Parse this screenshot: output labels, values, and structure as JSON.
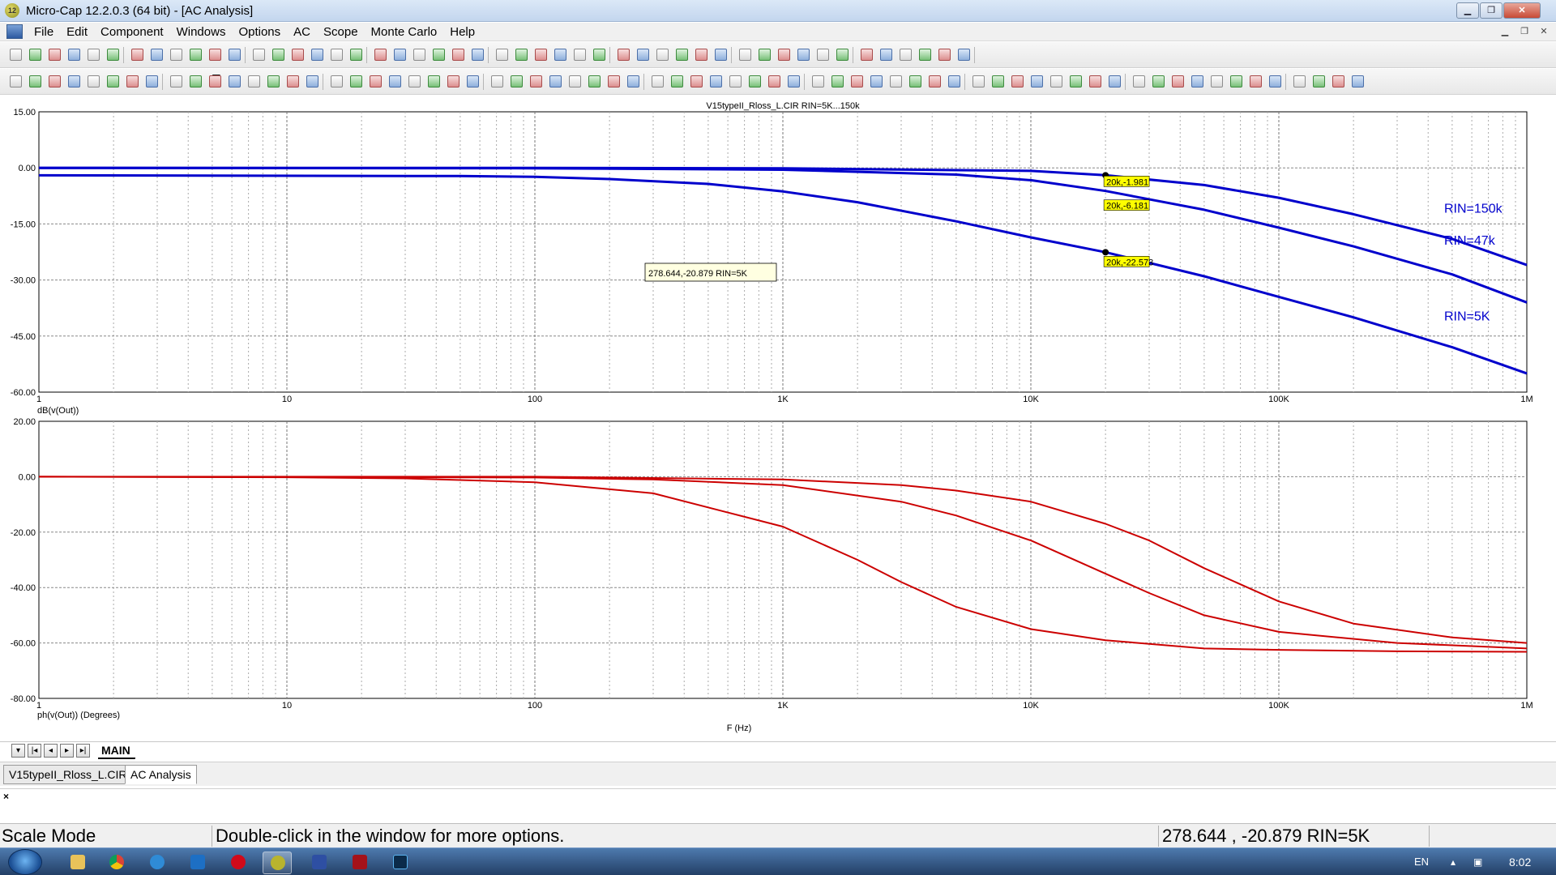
{
  "window": {
    "title": "Micro-Cap 12.2.0.3 (64 bit) - [AC Analysis]",
    "app_icon_label": "12"
  },
  "menu": [
    "File",
    "Edit",
    "Component",
    "Windows",
    "Options",
    "AC",
    "Scope",
    "Monte Carlo",
    "Help"
  ],
  "chart_data": [
    {
      "type": "line",
      "title": "V15typeII_Rloss_L.CIR RIN=5K...150k",
      "ylabel": "dB(v(Out))",
      "xlabel": "",
      "xscale": "log",
      "xlim": [
        1,
        1000000
      ],
      "ylim": [
        -60,
        15
      ],
      "y_ticks": [
        "15.00",
        "0.00",
        "-15.00",
        "-30.00",
        "-45.00",
        "-60.00"
      ],
      "x_ticks": [
        "1",
        "10",
        "100",
        "1K",
        "10K",
        "100K",
        "1M"
      ],
      "grid": true,
      "color": "#0000cc",
      "series": [
        {
          "name": "RIN=150k",
          "x": [
            1,
            100,
            1000,
            5000,
            10000,
            20000,
            50000,
            100000,
            200000,
            500000,
            1000000
          ],
          "values": [
            0,
            0,
            -0.1,
            -0.6,
            -0.8,
            -1.98,
            -4.6,
            -8,
            -12.4,
            -19,
            -26
          ]
        },
        {
          "name": "RIN=47k",
          "x": [
            1,
            100,
            1000,
            5000,
            10000,
            20000,
            50000,
            100000,
            200000,
            500000,
            1000000
          ],
          "values": [
            0,
            -0.1,
            -0.5,
            -1.8,
            -3.3,
            -6.18,
            -11.2,
            -16,
            -21,
            -28.5,
            -36
          ]
        },
        {
          "name": "RIN=5K",
          "x": [
            1,
            50,
            100,
            200,
            500,
            1000,
            2000,
            5000,
            10000,
            20000,
            50000,
            100000,
            200000,
            500000,
            1000000
          ],
          "values": [
            -2,
            -2.2,
            -2.4,
            -3,
            -4.3,
            -6.3,
            -9.2,
            -14.3,
            -18.6,
            -22.57,
            -29,
            -34.5,
            -40,
            -48,
            -55
          ]
        }
      ],
      "markers": [
        {
          "x": 20000,
          "y": -1.981,
          "label": "20k,-1.981"
        },
        {
          "x": 20000,
          "y": -6.181,
          "label": "20k,-6.181"
        },
        {
          "x": 20000,
          "y": -22.573,
          "label": "20k,-22.573"
        }
      ],
      "annotation": "278.644,-20.879 RIN=5K"
    },
    {
      "type": "line",
      "title": "",
      "ylabel": "ph(v(Out)) (Degrees)",
      "xlabel": "F (Hz)",
      "xscale": "log",
      "xlim": [
        1,
        1000000
      ],
      "ylim": [
        -80,
        20
      ],
      "y_ticks": [
        "20.00",
        "0.00",
        "-20.00",
        "-40.00",
        "-60.00",
        "-80.00"
      ],
      "x_ticks": [
        "1",
        "10",
        "100",
        "1K",
        "10K",
        "100K",
        "1M"
      ],
      "grid": true,
      "color": "#cc0000",
      "series": [
        {
          "x": [
            1,
            10,
            30,
            100,
            300,
            1000,
            2000,
            3000,
            5000,
            10000,
            20000,
            50000,
            100000,
            300000,
            1000000
          ],
          "values": [
            0,
            -0.2,
            -0.6,
            -2,
            -6,
            -18,
            -30,
            -38,
            -47,
            -55,
            -59,
            -62,
            -62.5,
            -63,
            -63.2
          ]
        },
        {
          "x": [
            1,
            100,
            300,
            1000,
            3000,
            5000,
            10000,
            20000,
            30000,
            50000,
            100000,
            300000,
            1000000
          ],
          "values": [
            0,
            -0.3,
            -1,
            -3,
            -9,
            -14,
            -23,
            -35,
            -42,
            -50,
            -56,
            -60,
            -62
          ]
        },
        {
          "x": [
            1,
            100,
            1000,
            3000,
            5000,
            10000,
            20000,
            30000,
            50000,
            100000,
            200000,
            500000,
            1000000
          ],
          "values": [
            0,
            0,
            -1,
            -3,
            -5,
            -9,
            -17,
            -23,
            -33,
            -45,
            -53,
            -58,
            -60
          ]
        }
      ]
    }
  ],
  "sheet_tabs": {
    "active": "MAIN",
    "nav": [
      "▾",
      "|◂",
      "◂",
      "▸",
      "▸|"
    ]
  },
  "doc_tabs": [
    "V15typeII_Rloss_L.CIR",
    "AC Analysis"
  ],
  "output_close": "×",
  "status": {
    "mode": "Scale Mode",
    "hint": "Double-click in the window for more options.",
    "coords": "278.644 , -20.879 RIN=5K"
  },
  "taskbar": {
    "lang": "EN",
    "clock": "8:02"
  },
  "colors": {
    "gain": "#0000cc",
    "phase": "#cc0000",
    "marker_label_bg": "#ffff00",
    "annotation_bg": "#ffffe1"
  }
}
